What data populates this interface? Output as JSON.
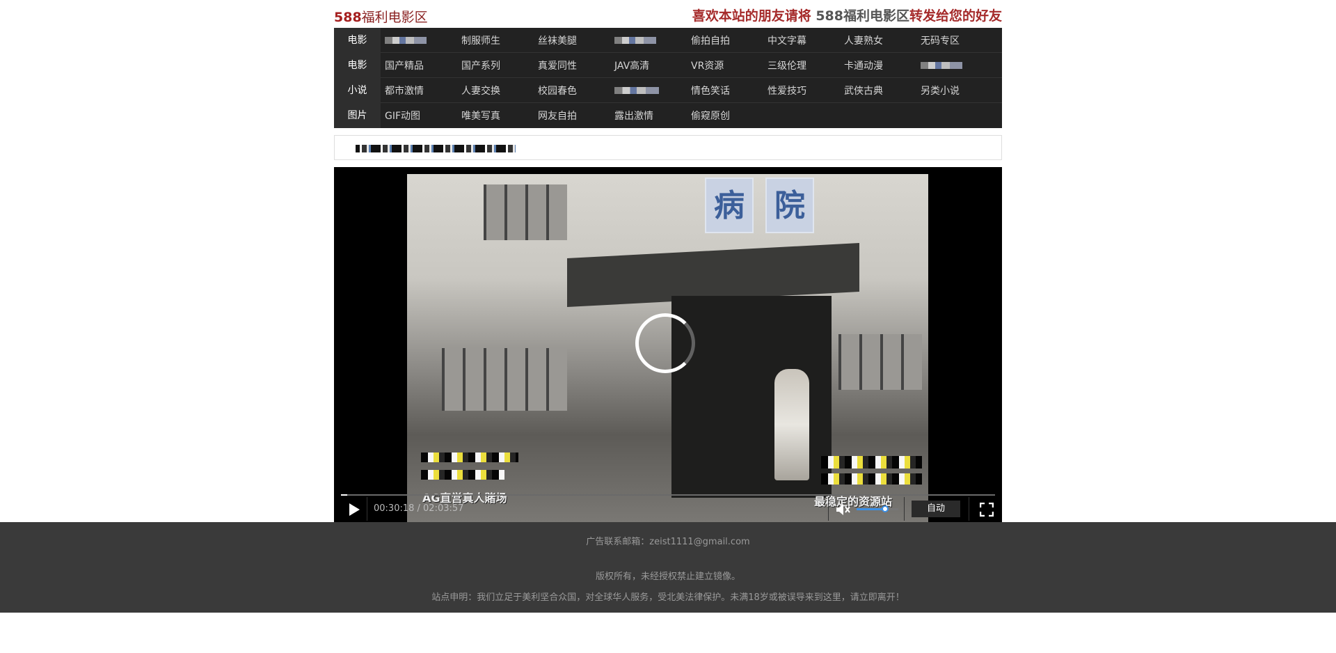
{
  "header": {
    "logo_num": "588",
    "logo_text": "福利电影区",
    "slogan_a": "喜欢本站的朋友请将 ",
    "slogan_b": "588福利电影区",
    "slogan_c": "转发给您的好友"
  },
  "nav": {
    "rows": [
      {
        "category": "电影",
        "links": [
          "",
          "制服师生",
          "丝袜美腿",
          "",
          "偷拍自拍",
          "中文字幕",
          "人妻熟女",
          "无码专区"
        ]
      },
      {
        "category": "电影",
        "links": [
          "国产精品",
          "国产系列",
          "真爱同性",
          "JAV高清",
          "VR资源",
          "三级伦理",
          "卡通动漫",
          ""
        ]
      },
      {
        "category": "小说",
        "links": [
          "都市激情",
          "人妻交换",
          "校园春色",
          "",
          "情色笑话",
          "性爱技巧",
          "武侠古典",
          "另类小说"
        ]
      },
      {
        "category": "图片",
        "links": [
          "GIF动图",
          "唯美写真",
          "网友自拍",
          "露出激情",
          "偷窥原创"
        ]
      }
    ]
  },
  "video": {
    "sign_char_1": "病",
    "sign_char_2": "院",
    "watermark_left": "AG直営真人賭场",
    "watermark_right": "最稳定的资源站",
    "time": "00:30:18 / 02:03:57",
    "quality": "自动",
    "progress_fraction": 0.01,
    "volume_fraction": 0.7
  },
  "footer": {
    "contact": "广告联系邮箱：zeist1111@gmail.com",
    "copyright": "版权所有，未经授权禁止建立镜像。",
    "statement": "站点申明：我们立足于美利坚合众国，对全球华人服务，受北美法律保护。未满18岁或被误导来到这里，请立即离开！"
  },
  "colors": {
    "brand_red": "#a51f1f",
    "nav_bg": "#222222",
    "footer_bg": "#3a3a3a",
    "volume_blue": "#3b8fe6"
  }
}
